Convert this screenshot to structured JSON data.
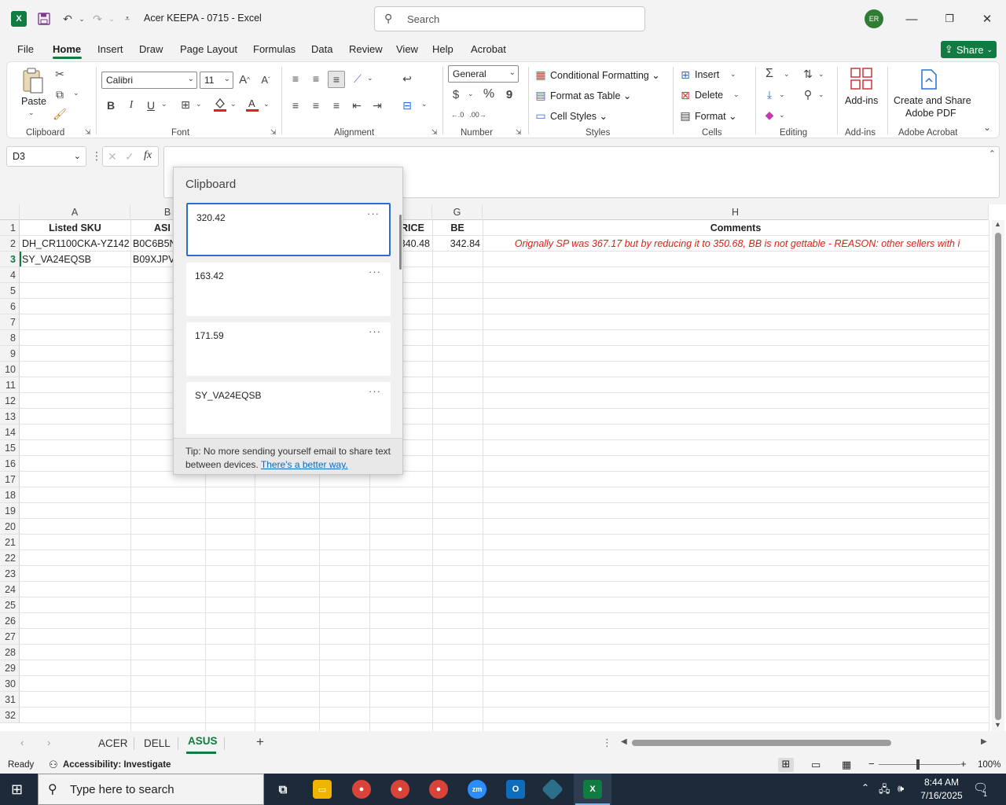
{
  "window": {
    "title": "Acer KEEPA - 0715  -  Excel",
    "search_placeholder": "Search",
    "avatar_initials": "ER"
  },
  "menu": {
    "tabs": [
      "File",
      "Home",
      "Insert",
      "Draw",
      "Page Layout",
      "Formulas",
      "Data",
      "Review",
      "View",
      "Help",
      "Acrobat"
    ],
    "share_label": "Share"
  },
  "ribbon": {
    "clipboard": {
      "paste": "Paste",
      "label": "Clipboard"
    },
    "font": {
      "name": "Calibri",
      "size": "11",
      "label": "Font",
      "bold": "B",
      "italic": "I",
      "underline": "U"
    },
    "alignment": {
      "label": "Alignment"
    },
    "number": {
      "format": "General",
      "label": "Number",
      "currency": "$",
      "percent": "%",
      "comma": "9"
    },
    "styles": {
      "conditional": "Conditional Formatting",
      "format_table": "Format as Table",
      "cell_styles": "Cell Styles",
      "label": "Styles"
    },
    "cells": {
      "insert": "Insert",
      "delete": "Delete",
      "format": "Format",
      "label": "Cells"
    },
    "editing": {
      "label": "Editing"
    },
    "addins": {
      "button": "Add-ins",
      "label": "Add-ins"
    },
    "acrobat": {
      "button_line1": "Create and Share",
      "button_line2": "Adobe PDF",
      "label": "Adobe Acrobat"
    }
  },
  "formula_bar": {
    "name_box": "D3",
    "fx": "fx"
  },
  "grid": {
    "columns": [
      {
        "letter": "A"
      },
      {
        "letter": "B"
      },
      {
        "letter": "G"
      },
      {
        "letter": "H"
      }
    ],
    "rows": [
      "1",
      "2",
      "3",
      "4",
      "5",
      "6",
      "7",
      "8",
      "9",
      "10",
      "11",
      "12",
      "13",
      "14",
      "15",
      "16",
      "17",
      "18",
      "19",
      "20",
      "21",
      "22",
      "23",
      "24",
      "25",
      "26",
      "27",
      "28",
      "29",
      "30",
      "31",
      "32"
    ],
    "row1": {
      "a": "Listed SKU",
      "b": "ASI",
      "f": "RICE",
      "g": "BE",
      "h": "Comments"
    },
    "row2": {
      "a": "DH_CR1100CKA-YZ142",
      "b": "B0C6B5N",
      "f": "340.48",
      "g": "342.84",
      "h": "Orignally SP was 367.17 but by reducing it to 350.68, BB is not gettable - REASON: other sellers with i"
    },
    "row3": {
      "a": "SY_VA24EQSB",
      "b": "B09XJPV"
    }
  },
  "clipboard_pane": {
    "title": "Clipboard",
    "items": [
      "320.42",
      "163.42",
      "171.59",
      "SY_VA24EQSB"
    ],
    "more": "···",
    "tip": "Tip: No more sending yourself email to share text between devices.",
    "tip_link": "There's a better way."
  },
  "sheets": {
    "tabs": [
      "ACER",
      "DELL",
      "ASUS"
    ],
    "active": "ASUS"
  },
  "status": {
    "ready": "Ready",
    "accessibility": "Accessibility: Investigate",
    "zoom": "100%"
  },
  "taskbar": {
    "search_placeholder": "Type here to search",
    "time": "8:44 AM",
    "date": "7/16/2025",
    "notif": "1"
  }
}
